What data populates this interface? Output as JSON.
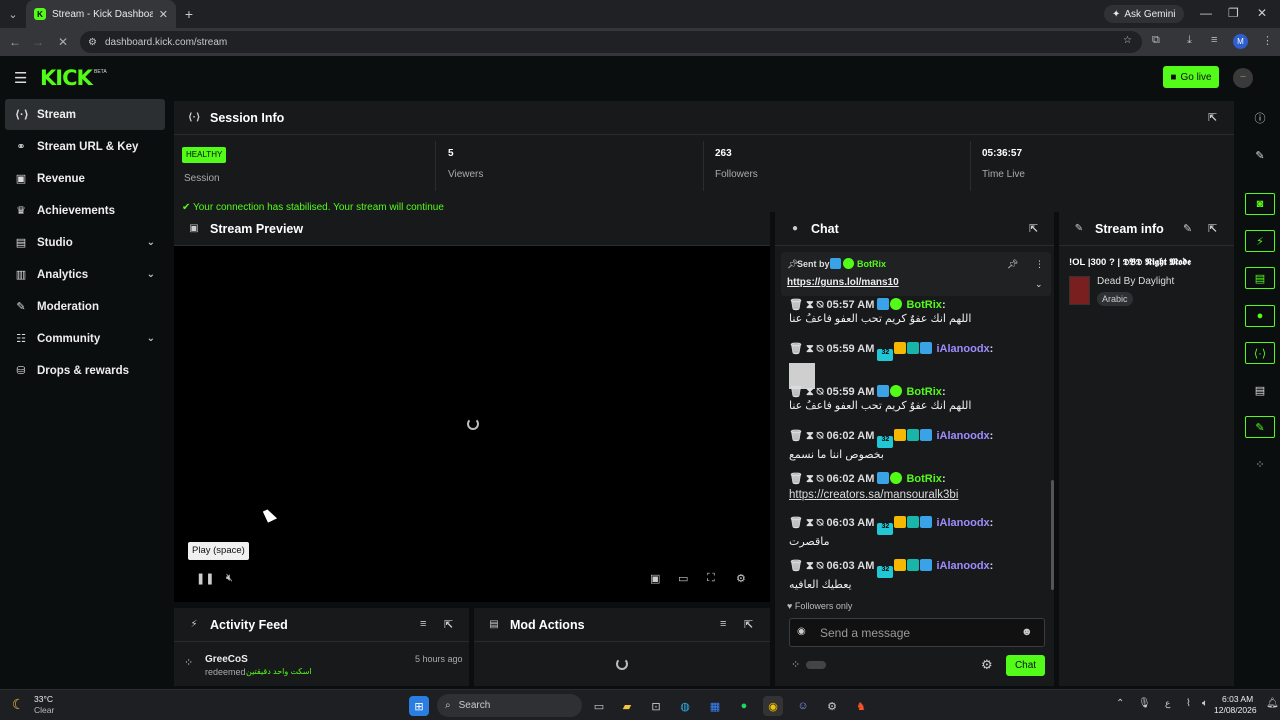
{
  "browser": {
    "tab_title": "Stream - Kick Dashboard",
    "tab_favicon": "K",
    "ask_gemini": "Ask Gemini",
    "url": "dashboard.kick.com/stream",
    "profile_initial": "M"
  },
  "header": {
    "logo": "KICK",
    "beta": "BETA",
    "go_live": "Go live"
  },
  "sidebar": {
    "items": [
      {
        "label": "Stream",
        "icon": "broadcast-icon",
        "glyph": "((·))"
      },
      {
        "label": "Stream URL & Key",
        "icon": "link-icon",
        "glyph": "⚭"
      },
      {
        "label": "Revenue",
        "icon": "revenue-icon",
        "glyph": "▣"
      },
      {
        "label": "Achievements",
        "icon": "trophy-icon",
        "glyph": "♛"
      },
      {
        "label": "Studio",
        "icon": "studio-icon",
        "glyph": "▤"
      },
      {
        "label": "Analytics",
        "icon": "analytics-icon",
        "glyph": "▥"
      },
      {
        "label": "Moderation",
        "icon": "wrench-icon",
        "glyph": "✎"
      },
      {
        "label": "Community",
        "icon": "community-icon",
        "glyph": "☷"
      },
      {
        "label": "Drops & rewards",
        "icon": "drops-icon",
        "glyph": "⛁"
      }
    ]
  },
  "session": {
    "title": "Session Info",
    "health": "HEALTHY",
    "health_label": "Session",
    "viewers": "5",
    "viewers_label": "Viewers",
    "followers": "263",
    "followers_label": "Followers",
    "time_live": "05:36:57",
    "time_live_label": "Time Live",
    "notice": "Your connection has stabilised. Your stream will continue"
  },
  "preview": {
    "title": "Stream Preview",
    "tooltip": "Play (space)"
  },
  "activity": {
    "title": "Activity Feed",
    "user": "GreeCoS",
    "time": "5 hours ago",
    "action": "redeemed",
    "reward": "اسكت واحد دقيقتين"
  },
  "mod": {
    "title": "Mod Actions"
  },
  "chat": {
    "title": "Chat",
    "pinned_sent_by": "Sent by",
    "pinned_user": "BotRix",
    "pinned_link": "https://guns.lol/mans10",
    "messages": [
      {
        "time": "05:57 AM",
        "user": "BotRix",
        "text": "اللهم انك عفوٌ كريم تحب العفو فاعفُ عنا",
        "kind": "bot"
      },
      {
        "time": "05:59 AM",
        "user": "iAlanoodx",
        "text": "",
        "kind": "user"
      },
      {
        "time": "05:59 AM",
        "user": "BotRix",
        "text": "اللهم انك عفوٌ كريم تحب العفو فاعفُ عنا",
        "kind": "bot"
      },
      {
        "time": "06:02 AM",
        "user": "iAlanoodx",
        "text": "بخصوص اننا ما نسمع",
        "kind": "user"
      },
      {
        "time": "06:02 AM",
        "user": "BotRix",
        "text": "https://creators.sa/mansouralk3bi",
        "kind": "bot"
      },
      {
        "time": "06:03 AM",
        "user": "iAlanoodx",
        "text": "ماقصرت",
        "kind": "user"
      },
      {
        "time": "06:03 AM",
        "user": "iAlanoodx",
        "text": "يعطيك العافيه",
        "kind": "user"
      }
    ],
    "followers_only": "Followers only",
    "placeholder": "Send a message",
    "send": "Chat",
    "sub_badge": "32"
  },
  "stream_info": {
    "title": "Stream info",
    "stream_title": "!OL |300 ? | 𝕯𝕭𝕯 𝕹𝖎𝖌𝖍𝖙 𝕸𝖔𝖉𝖊",
    "category": "Dead By Daylight",
    "language": "Arabic"
  },
  "taskbar": {
    "temp": "33°C",
    "weather": "Clear",
    "search": "Search",
    "time": "6:03 AM",
    "date": "12/08/2026"
  },
  "colors": {
    "accent": "#53fc18",
    "panel": "#18191b",
    "background": "#0b0e0f",
    "username_purple": "#9f8cff"
  }
}
